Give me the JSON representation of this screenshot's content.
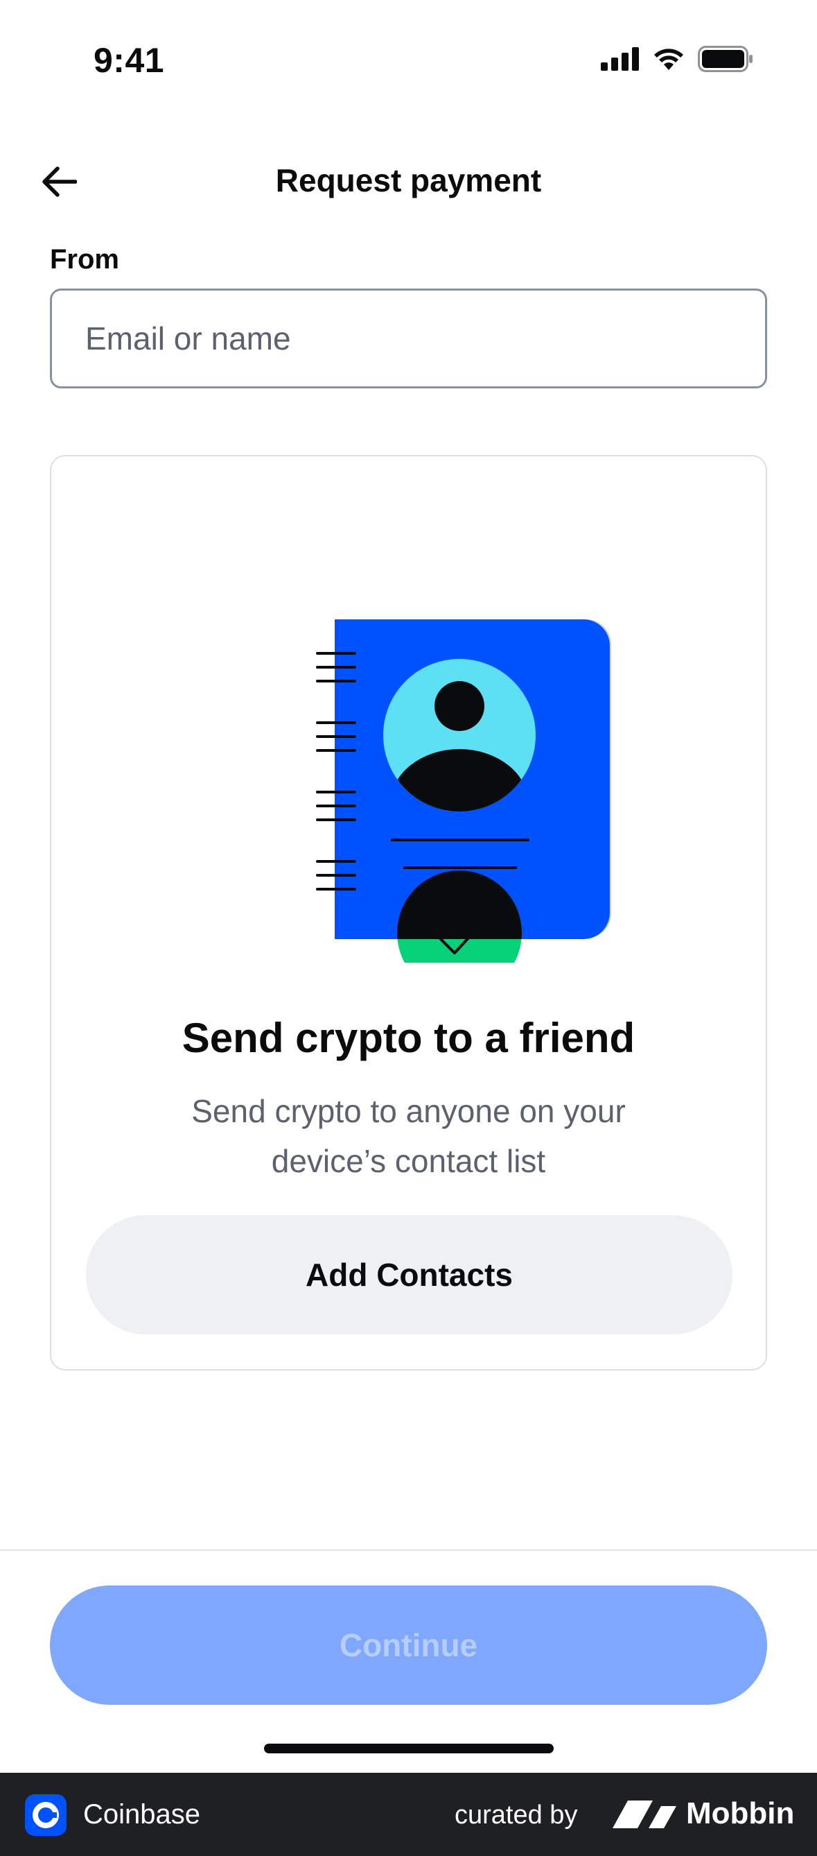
{
  "status_bar": {
    "time": "9:41"
  },
  "nav": {
    "title": "Request payment"
  },
  "form": {
    "from_label": "From",
    "from_placeholder": "Email or name",
    "from_value": ""
  },
  "card": {
    "title": "Send crypto to a friend",
    "subtitle": "Send crypto to anyone on your device’s contact list",
    "button_label": "Add Contacts"
  },
  "footer_action": {
    "continue_label": "Continue"
  },
  "branding": {
    "app_name": "Coinbase",
    "curated_by": "curated by",
    "mobbin": "Mobbin"
  },
  "colors": {
    "brand_blue": "#0052ff",
    "continue_disabled": "#7fa7fb",
    "success_green": "#05d179",
    "avatar_cyan": "#5ee0f4"
  },
  "icons": {
    "back": "arrow-left-icon",
    "signal": "cellular-signal-icon",
    "wifi": "wifi-icon",
    "battery": "battery-icon",
    "illustration": "address-book-check-illustration"
  }
}
